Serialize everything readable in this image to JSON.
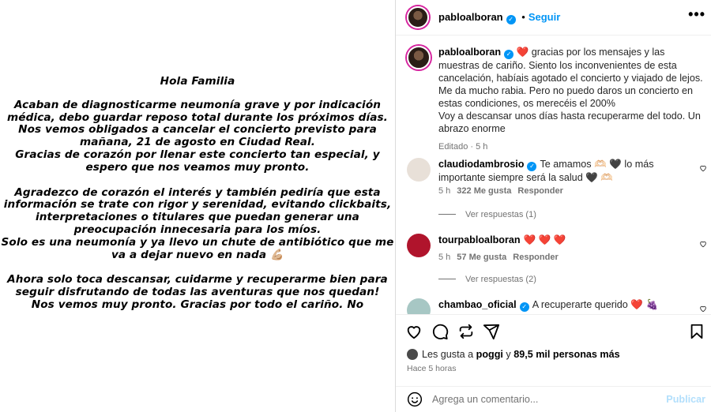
{
  "story": {
    "greeting": "Hola Familia",
    "p1": [
      "Acaban de diagnosticarme neumonía grave y por indicación",
      "médica, debo guardar reposo total durante los próximos días.",
      "Nos vemos obligados a cancelar el concierto previsto para",
      "mañana, 21 de agosto en Ciudad Real.",
      "Gracias de corazón por llenar este concierto tan especial, y",
      "espero que nos veamos muy pronto."
    ],
    "p2": [
      "Agradezco de corazón el interés y también pediría que esta",
      "información se trate con rigor y serenidad, evitando clickbaits,",
      "interpretaciones o titulares que puedan generar una",
      "preocupación innecesaria para los míos.",
      "Solo es una neumonía y ya llevo un chute de antibiótico que me",
      "va a dejar nuevo en nada 💪🏼"
    ],
    "p3": [
      "Ahora solo toca descansar, cuidarme y recuperarme bien para",
      "seguir disfrutando de todas las aventuras que nos quedan!",
      "Nos vemos muy pronto. Gracias por todo el cariño. No"
    ]
  },
  "header": {
    "username": "pabloalboran",
    "separator": "•",
    "follow_label": "Seguir",
    "more_label": "•••"
  },
  "caption": {
    "username": "pabloalboran",
    "heart": "❤️",
    "text": "gracias por los mensajes y las muestras de cariño. Siento los inconvenientes de esta cancelación, habíais agotado el concierto y viajado de lejos. Me da mucho rabia. Pero no puedo daros un concierto en estas condiciones, os merecéis el 200%",
    "text2": "Voy a descansar unos días hasta recuperarme del todo. Un abrazo enorme",
    "meta": "Editado · 5 h"
  },
  "comments": [
    {
      "username": "claudiodambrosio",
      "verified": true,
      "text": "Te amamos 🫶🏻 🖤 lo más importante siempre será la salud 🖤 🫶🏻",
      "time": "5 h",
      "likes": "322 Me gusta",
      "reply": "Responder",
      "view_replies": "Ver respuestas (1)",
      "avatar_color": "#e8e0d8"
    },
    {
      "username": "tourpabloalboran",
      "verified": false,
      "text": "❤️ ❤️ ❤️",
      "time": "5 h",
      "likes": "57 Me gusta",
      "reply": "Responder",
      "view_replies": "Ver respuestas (2)",
      "avatar_color": "#b0142c"
    },
    {
      "username": "chambao_oficial",
      "verified": true,
      "text": "A recuperarte querido ❤️ 🍇",
      "avatar_color": "#a7c7c4"
    }
  ],
  "likes": {
    "prefix": "Les gusta a",
    "user": "poggi",
    "middle": "y",
    "count": "89,5 mil personas más"
  },
  "posted_ago": "Hace 5 horas",
  "comment_box": {
    "placeholder": "Agrega un comentario...",
    "publish_label": "Publicar"
  },
  "colors": {
    "accent": "#0095f6",
    "heart": "#ed4956",
    "muted": "#737373",
    "publish_disabled": "#b2dffc"
  }
}
